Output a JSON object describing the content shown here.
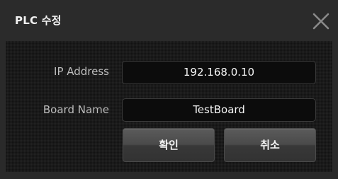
{
  "dialog": {
    "title": "PLC 수정",
    "close_icon": "close-x-icon"
  },
  "form": {
    "ip_label": "IP Address",
    "ip_value": "192.168.0.10",
    "board_label": "Board Name",
    "board_value": "TestBoard"
  },
  "buttons": {
    "confirm_label": "확인",
    "cancel_label": "취소"
  },
  "colors": {
    "title_bar": "#2b2b2b",
    "panel": "#121212",
    "field_bg": "#0c0c0c",
    "button_top": "#5b5b5b",
    "button_bottom": "#323232",
    "close_icon": "#8a8a8a"
  }
}
